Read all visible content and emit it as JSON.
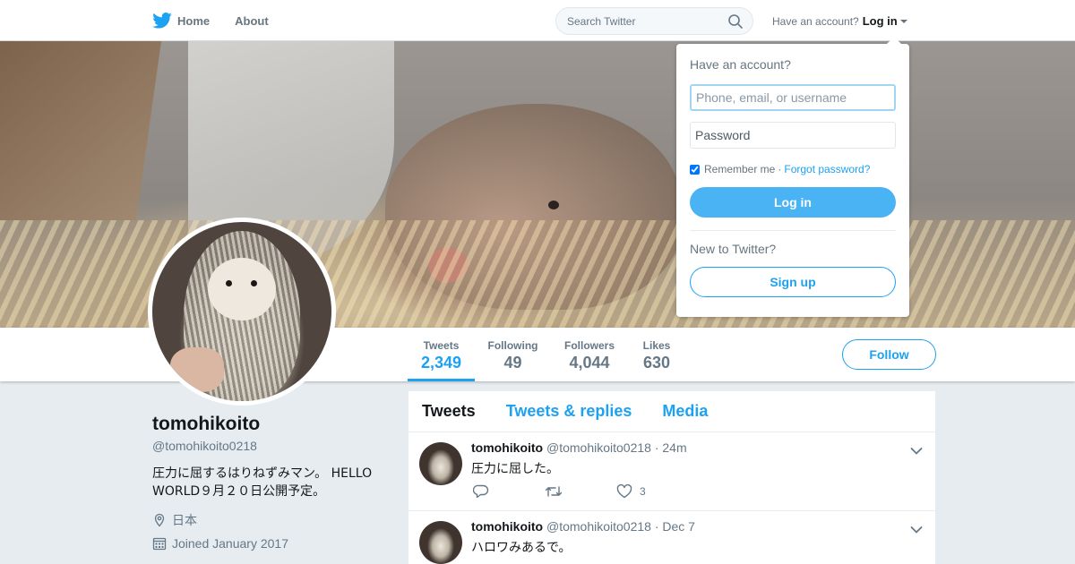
{
  "topbar": {
    "home_label": "Home",
    "about_label": "About",
    "search_placeholder": "Search Twitter",
    "have_account": "Have an account?",
    "login_label": "Log in"
  },
  "profile_nav": {
    "stats": [
      {
        "label": "Tweets",
        "value": "2,349",
        "active": true
      },
      {
        "label": "Following",
        "value": "49"
      },
      {
        "label": "Followers",
        "value": "4,044"
      },
      {
        "label": "Likes",
        "value": "630"
      }
    ],
    "follow_label": "Follow"
  },
  "profile": {
    "name": "tomohikoito",
    "handle": "@tomohikoito0218",
    "bio": "圧力に屈するはりねずみマン。 HELLO WORLD９月２０日公開予定。",
    "location": "日本",
    "joined": "Joined January 2017"
  },
  "timeline": {
    "tabs": [
      "Tweets",
      "Tweets & replies",
      "Media"
    ],
    "tweets": [
      {
        "name": "tomohikoito",
        "handle": "@tomohikoito0218",
        "time": "· 24m",
        "text": "圧力に屈した。",
        "likes": "3"
      },
      {
        "name": "tomohikoito",
        "handle": "@tomohikoito0218",
        "time": "· Dec 7",
        "text": "ハロワみあるで。"
      }
    ]
  },
  "login_dropdown": {
    "title": "Have an account?",
    "username_placeholder": "Phone, email, or username",
    "password_placeholder": "Password",
    "remember_label": "Remember me",
    "separator": "·",
    "forgot_label": "Forgot password?",
    "login_button": "Log in",
    "new_label": "New to Twitter?",
    "signup_button": "Sign up"
  },
  "colors": {
    "accent": "#1da1f2",
    "login_button_bg": "#4ab3f4",
    "page_bg": "#e6ecf0"
  }
}
